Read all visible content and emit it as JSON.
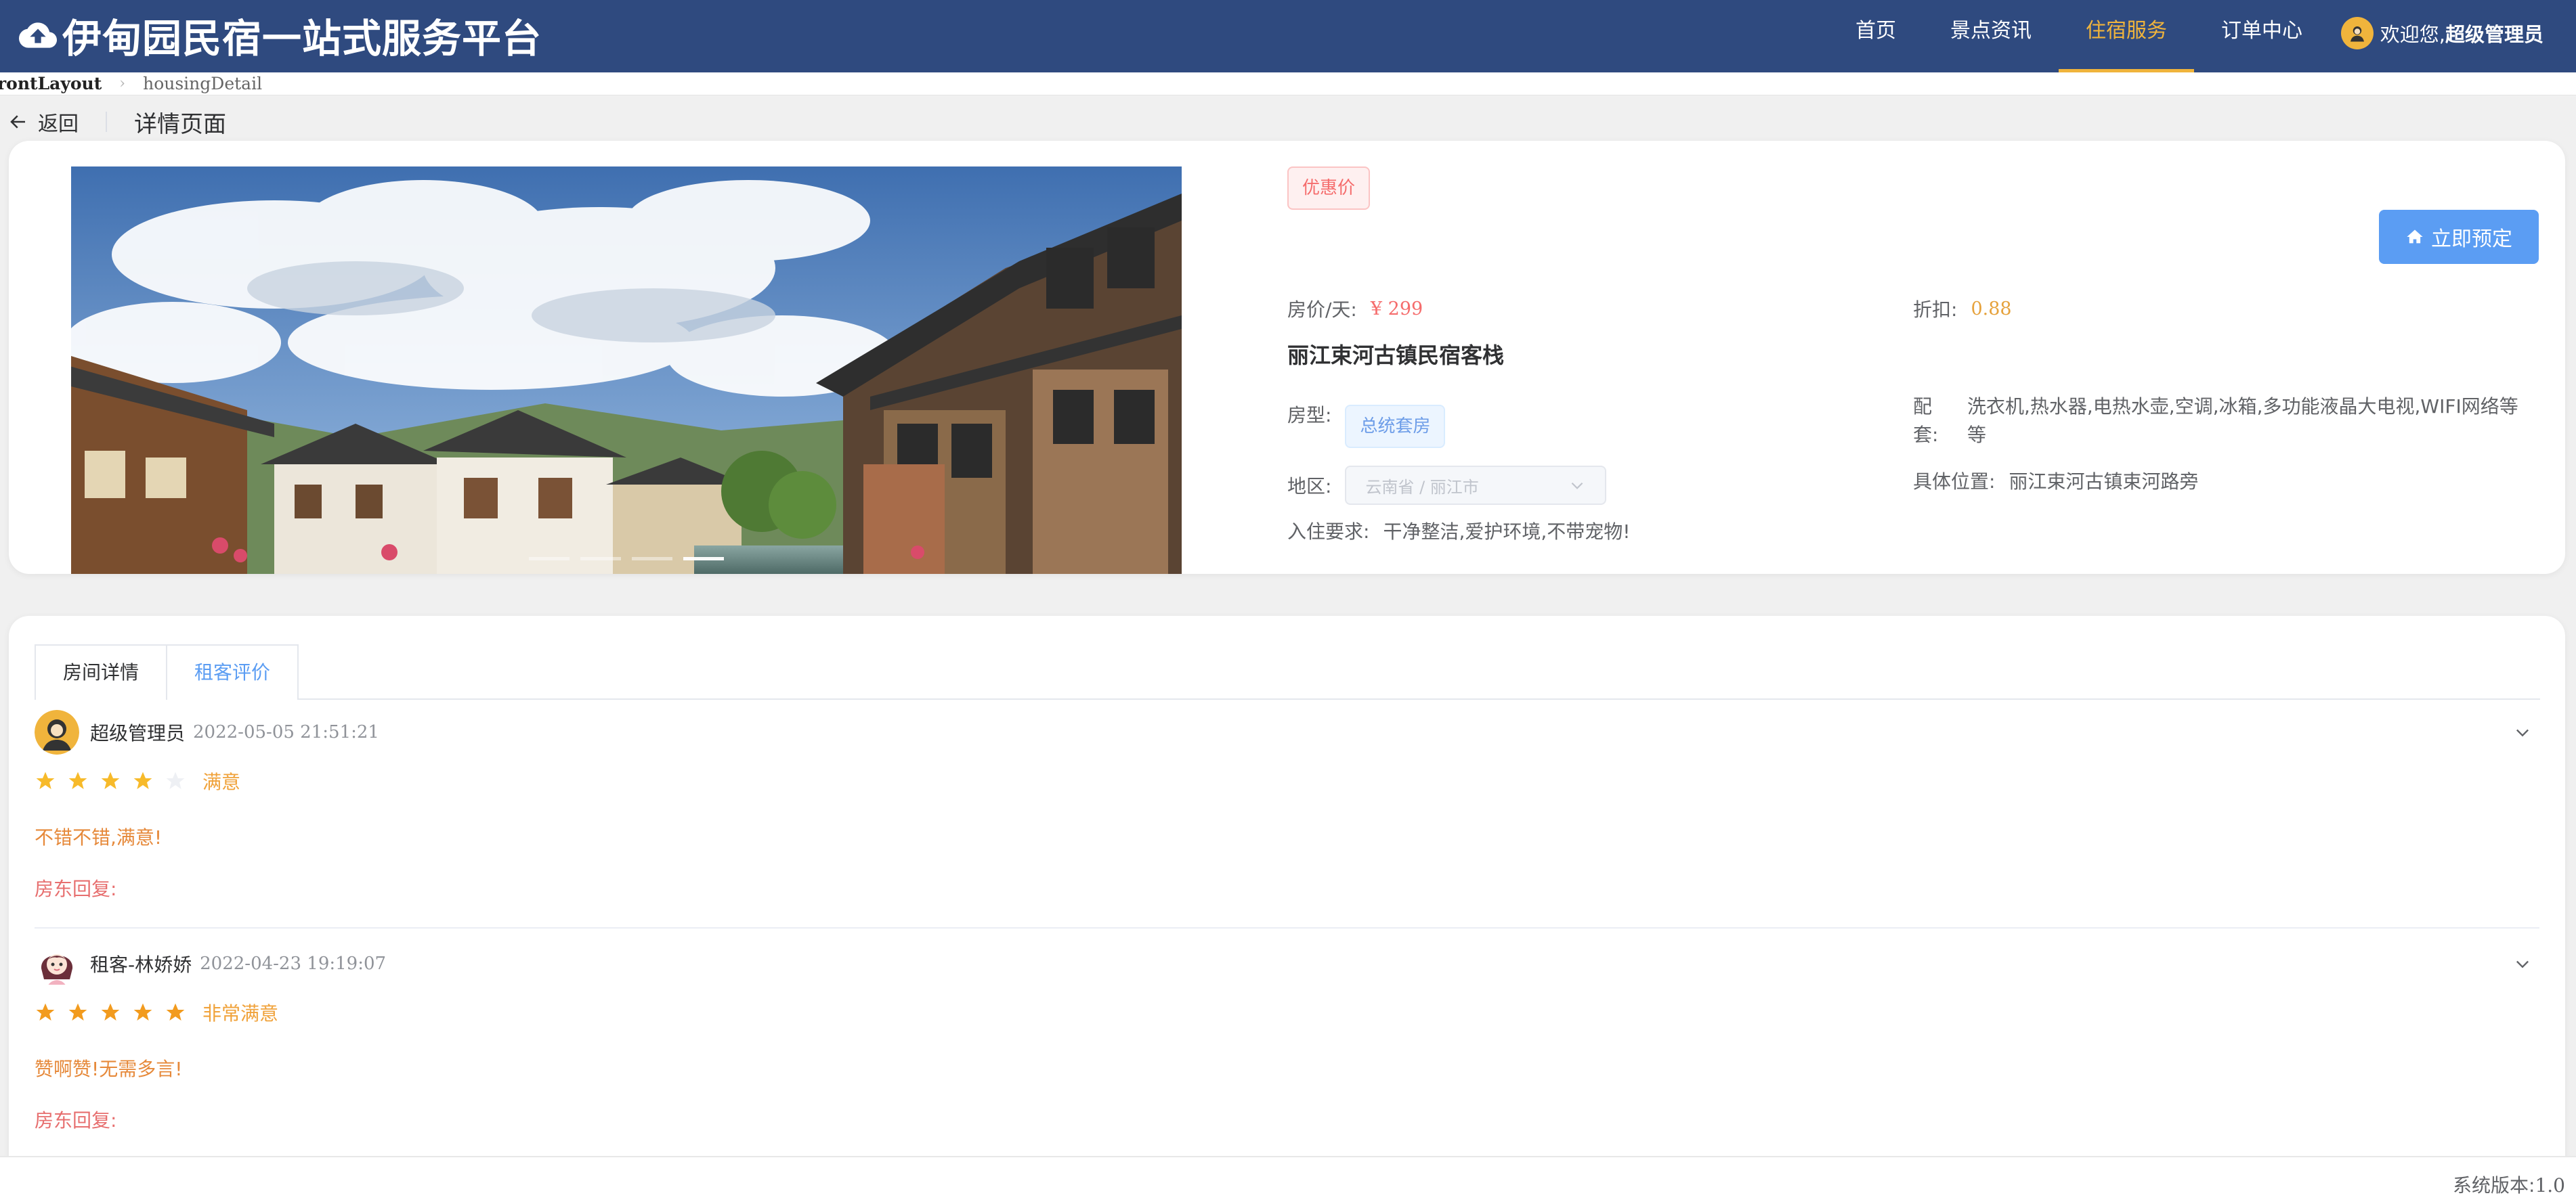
{
  "header": {
    "title": "伊甸园民宿一站式服务平台",
    "nav": [
      {
        "label": "首页",
        "active": false
      },
      {
        "label": "景点资讯",
        "active": false
      },
      {
        "label": "住宿服务",
        "active": true
      },
      {
        "label": "订单中心",
        "active": false
      }
    ],
    "welcome": "欢迎您,",
    "username": "超级管理员",
    "accent_color": "#f0b43c",
    "bg_color": "#2f4a7f"
  },
  "breadcrumb": {
    "first": "rontLayout",
    "last": "housingDetail"
  },
  "page_header": {
    "back_label": "返回",
    "title": "详情页面"
  },
  "detail": {
    "discount_tag": "优惠价",
    "book_button": "立即预定",
    "price_label": "房价/天:",
    "price_value": "¥ 299",
    "discount_label": "折扣:",
    "discount_value": "0.88",
    "house_name": "丽江束河古镇民宿客栈",
    "type_label": "房型:",
    "type_value": "总统套房",
    "equipment_label": "配套:",
    "equipment_value": "洗衣机,热水器,电热水壶,空调,冰箱,多功能液晶大电视,WIFI网络等等",
    "region_label": "地区:",
    "region_value": "云南省 / 丽江市",
    "location_label": "具体位置:",
    "location_value": "丽江束河古镇束河路旁",
    "requirement_label": "入住要求:",
    "requirement_value": "干净整洁,爱护环境,不带宠物!",
    "carousel_active_index": 3,
    "carousel_count": 4
  },
  "tabs": [
    {
      "label": "房间详情",
      "active": true
    },
    {
      "label": "租客评价",
      "active": false
    }
  ],
  "comments": [
    {
      "user": "超级管理员",
      "time": "2022-05-05 21:51:21",
      "rating": 4,
      "rating_text": "满意",
      "content": "不错不错,满意!",
      "reply_label": "房东回复:"
    },
    {
      "user": "租客-林娇娇",
      "time": "2022-04-23 19:19:07",
      "rating": 5,
      "rating_text": "非常满意",
      "content": "赞啊赞!无需多言!",
      "reply_label": "房东回复:"
    }
  ],
  "footer": {
    "version_label": "系统版本:",
    "version_value": "1.0"
  }
}
